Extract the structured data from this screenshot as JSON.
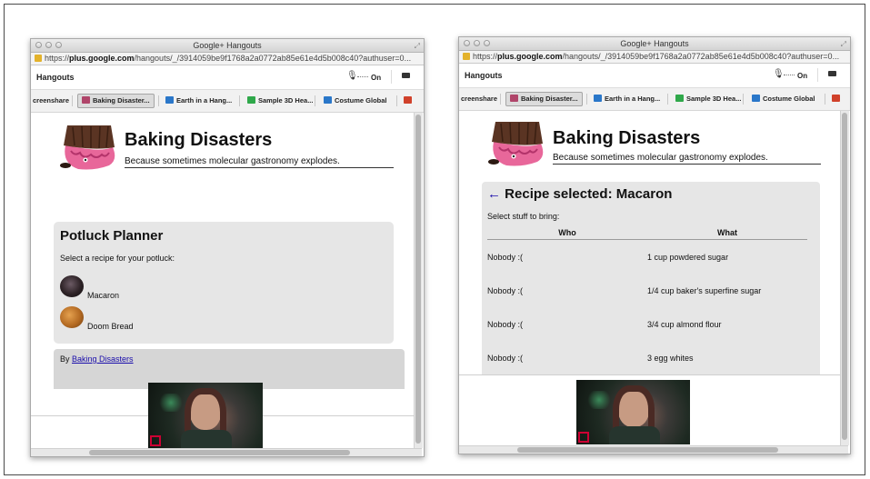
{
  "colors": {
    "panel": "#e6e6e6",
    "link": "#1a0dab",
    "footer": "#d6d6d6"
  },
  "windows": [
    {
      "title": "Google+ Hangouts",
      "url_prefix": "https://",
      "url_host": "plus.google.com",
      "url_path": "/hangouts/_/3914059be9f1768a2a0772ab85e61e4d5b008c40?authuser=0...",
      "app_title": "Hangouts",
      "mic_label": "On",
      "tabs": [
        "creenshare",
        "Baking Disaster...",
        "Earth in a Hang...",
        "Sample 3D Hea...",
        "Costume Global"
      ],
      "site_title": "Baking Disasters",
      "tagline": "Because sometimes molecular gastronomy explodes.",
      "planner": {
        "heading": "Potluck Planner",
        "prompt": "Select a recipe for your potluck:",
        "recipes": [
          {
            "name": "Macaron",
            "icon": "macaron-icon"
          },
          {
            "name": "Doom Bread",
            "icon": "cookie-icon"
          }
        ]
      },
      "footer": {
        "by_label": "By",
        "link_text": "Baking Disasters"
      }
    },
    {
      "title": "Google+ Hangouts",
      "url_prefix": "https://",
      "url_host": "plus.google.com",
      "url_path": "/hangouts/_/3914059be9f1768a2a0772ab85e61e4d5b008c40?authuser=0...",
      "app_title": "Hangouts",
      "mic_label": "On",
      "tabs": [
        "creenshare",
        "Baking Disaster...",
        "Earth in a Hang...",
        "Sample 3D Hea...",
        "Costume Global"
      ],
      "site_title": "Baking Disasters",
      "tagline": "Because sometimes molecular gastronomy explodes.",
      "recipe": {
        "back_arrow": "←",
        "heading": "Recipe selected: Macaron",
        "prompt": "Select stuff to bring:",
        "columns": [
          "Who",
          "What"
        ],
        "rows": [
          {
            "who": "Nobody :(",
            "what": "1 cup powdered sugar"
          },
          {
            "who": "Nobody :(",
            "what": "1/4 cup baker's superfine sugar"
          },
          {
            "who": "Nobody :(",
            "what": "3/4 cup almond flour"
          },
          {
            "who": "Nobody :(",
            "what": "3 egg whites"
          }
        ]
      }
    }
  ]
}
